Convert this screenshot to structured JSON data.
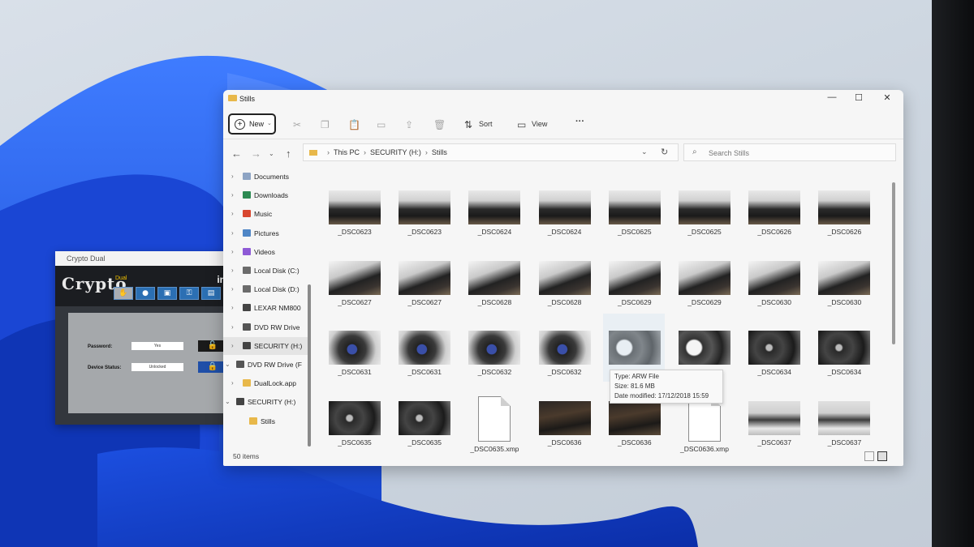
{
  "crypto_app": {
    "title": "Crypto Dual",
    "logo": "Crypto",
    "logo_sub": "Dual",
    "brand": "int",
    "toolbar_icons": [
      "hand-icon",
      "group-icon",
      "id-card-icon",
      "key-icon",
      "card-icon"
    ],
    "password_label": "Password:",
    "password_value": "Yes",
    "device_status_label": "Device Status:",
    "device_status_value": "Unlocked"
  },
  "explorer": {
    "title": "Stills",
    "window_controls": {
      "minimize": "—",
      "maximize": "☐",
      "close": "✕"
    },
    "command_bar": {
      "new_label": "New",
      "sort_label": "Sort",
      "view_label": "View",
      "more_label": "···"
    },
    "breadcrumb": [
      "This PC",
      "SECURITY (H:)",
      "Stills"
    ],
    "search_placeholder": "Search Stills",
    "sidebar": [
      {
        "label": "Documents",
        "icon": "documents-icon",
        "color": "#8da4c4",
        "indent": 0
      },
      {
        "label": "Downloads",
        "icon": "downloads-icon",
        "color": "#2d8a53",
        "indent": 0
      },
      {
        "label": "Music",
        "icon": "music-icon",
        "color": "#d8472f",
        "indent": 0
      },
      {
        "label": "Pictures",
        "icon": "pictures-icon",
        "color": "#4f86c6",
        "indent": 0
      },
      {
        "label": "Videos",
        "icon": "videos-icon",
        "color": "#8e5ad6",
        "indent": 0
      },
      {
        "label": "Local Disk (C:)",
        "icon": "drive-icon",
        "color": "#6b6b6b",
        "indent": 0
      },
      {
        "label": "Local Disk (D:)",
        "icon": "drive-icon",
        "color": "#6b6b6b",
        "indent": 0
      },
      {
        "label": "LEXAR NM800",
        "icon": "drive-icon",
        "color": "#444444",
        "indent": 0
      },
      {
        "label": "DVD RW Drive",
        "icon": "dvd-icon",
        "color": "#555555",
        "indent": 0
      },
      {
        "label": "SECURITY (H:)",
        "icon": "usb-drive-icon",
        "color": "#444444",
        "indent": 0,
        "selected": true
      },
      {
        "label": "DVD RW Drive (F",
        "icon": "dvd-icon",
        "color": "#555555",
        "indent": -1
      },
      {
        "label": "DualLock.app",
        "icon": "folder-icon",
        "color": "#e8b84a",
        "indent": 0
      },
      {
        "label": "SECURITY (H:)",
        "icon": "usb-drive-icon",
        "color": "#444444",
        "indent": -1
      },
      {
        "label": "Stills",
        "icon": "folder-icon",
        "color": "#e8b84a",
        "indent": 1
      }
    ],
    "files": [
      {
        "name": "_DSC0623",
        "kind": "photo",
        "tone": "car-grille"
      },
      {
        "name": "_DSC0623",
        "kind": "photo",
        "tone": "car-grille"
      },
      {
        "name": "_DSC0624",
        "kind": "photo",
        "tone": "car-grille"
      },
      {
        "name": "_DSC0624",
        "kind": "photo",
        "tone": "car-grille"
      },
      {
        "name": "_DSC0625",
        "kind": "photo",
        "tone": "car-grille"
      },
      {
        "name": "_DSC0625",
        "kind": "photo",
        "tone": "car-grille"
      },
      {
        "name": "_DSC0626",
        "kind": "photo",
        "tone": "car-grille"
      },
      {
        "name": "_DSC0626",
        "kind": "photo",
        "tone": "car-grille"
      },
      {
        "name": "_DSC0627",
        "kind": "photo",
        "tone": "car-front"
      },
      {
        "name": "_DSC0627",
        "kind": "photo",
        "tone": "car-front"
      },
      {
        "name": "_DSC0628",
        "kind": "photo",
        "tone": "car-front"
      },
      {
        "name": "_DSC0628",
        "kind": "photo",
        "tone": "car-front"
      },
      {
        "name": "_DSC0629",
        "kind": "photo",
        "tone": "car-front"
      },
      {
        "name": "_DSC0629",
        "kind": "photo",
        "tone": "car-front"
      },
      {
        "name": "_DSC0630",
        "kind": "photo",
        "tone": "car-front"
      },
      {
        "name": "_DSC0630",
        "kind": "photo",
        "tone": "car-front"
      },
      {
        "name": "_DSC0631",
        "kind": "photo",
        "tone": "engine-blue"
      },
      {
        "name": "_DSC0631",
        "kind": "photo",
        "tone": "engine-blue"
      },
      {
        "name": "_DSC0632",
        "kind": "photo",
        "tone": "engine-blue"
      },
      {
        "name": "_DSC0632",
        "kind": "photo",
        "tone": "engine-blue"
      },
      {
        "name": "",
        "kind": "photo",
        "tone": "engine-white"
      },
      {
        "name": "",
        "kind": "photo",
        "tone": "engine-white"
      },
      {
        "name": "_DSC0634",
        "kind": "photo",
        "tone": "engine-dark"
      },
      {
        "name": "_DSC0634",
        "kind": "photo",
        "tone": "engine-dark"
      },
      {
        "name": "_DSC0635",
        "kind": "photo",
        "tone": "engine-dark"
      },
      {
        "name": "_DSC0635",
        "kind": "photo",
        "tone": "engine-dark"
      },
      {
        "name": "_DSC0635.xmp",
        "kind": "document",
        "tone": ""
      },
      {
        "name": "_DSC0636",
        "kind": "photo",
        "tone": "engine-brown"
      },
      {
        "name": "_DSC0636",
        "kind": "photo",
        "tone": "engine-brown"
      },
      {
        "name": "_DSC0636.xmp",
        "kind": "document",
        "tone": ""
      },
      {
        "name": "_DSC0637",
        "kind": "photo",
        "tone": "car-rear"
      },
      {
        "name": "_DSC0637",
        "kind": "photo",
        "tone": "car-rear"
      }
    ],
    "tooltip": {
      "type": "Type: ARW File",
      "size": "Size: 81.6 MB",
      "date": "Date modified: 17/12/2018 15:59"
    },
    "status_count": "50 items"
  }
}
